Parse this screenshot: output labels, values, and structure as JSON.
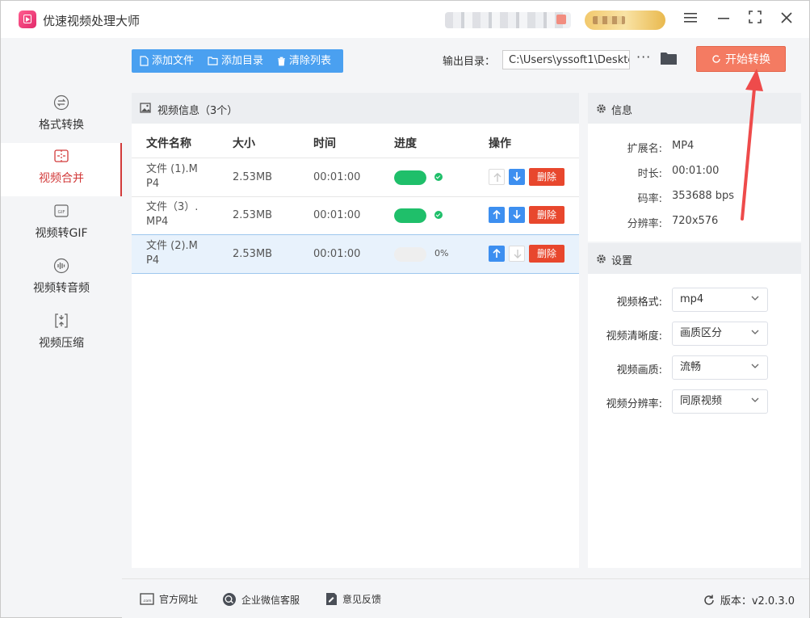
{
  "app": {
    "title": "优速视频处理大师"
  },
  "sidebar": {
    "items": [
      {
        "label": "格式转换",
        "icon": "format-convert-icon",
        "active": false
      },
      {
        "label": "视频合并",
        "icon": "video-merge-icon",
        "active": true
      },
      {
        "label": "视频转GIF",
        "icon": "gif-icon",
        "active": false
      },
      {
        "label": "视频转音频",
        "icon": "audio-icon",
        "active": false
      },
      {
        "label": "视频压缩",
        "icon": "compress-icon",
        "active": false
      }
    ]
  },
  "toolbar": {
    "add_file": "添加文件",
    "add_dir": "添加目录",
    "clear_list": "清除列表",
    "output_label": "输出目录：",
    "output_path": "C:\\Users\\yssoft1\\Deskto",
    "more": "···",
    "start": "开始转换"
  },
  "list": {
    "title": "视频信息（3个）",
    "columns": {
      "name": "文件名称",
      "size": "大小",
      "time": "时间",
      "progress": "进度",
      "actions": "操作"
    },
    "rows": [
      {
        "name": "文件 (1).M\nP4",
        "size": "2.53MB",
        "time": "00:01:00",
        "progress": 1.0,
        "done": true,
        "pct": "",
        "up_enabled": false,
        "down_enabled": true
      },
      {
        "name": "文件（3）.\nMP4",
        "size": "2.53MB",
        "time": "00:01:00",
        "progress": 1.0,
        "done": true,
        "pct": "",
        "up_enabled": true,
        "down_enabled": true
      },
      {
        "name": "文件 (2).M\nP4",
        "size": "2.53MB",
        "time": "00:01:00",
        "progress": 0.0,
        "done": false,
        "pct": "0%",
        "up_enabled": true,
        "down_enabled": false
      }
    ],
    "delete_label": "删除"
  },
  "info": {
    "title": "信息",
    "ext_label": "扩展名:",
    "ext": "MP4",
    "duration_label": "时长:",
    "duration": "00:01:00",
    "bitrate_label": "码率:",
    "bitrate": "353688 bps",
    "resolution_label": "分辨率:",
    "resolution": "720x576"
  },
  "settings": {
    "title": "设置",
    "format_label": "视频格式:",
    "format": "mp4",
    "clarity_label": "视频清晰度:",
    "clarity": "画质区分",
    "quality_label": "视频画质:",
    "quality": "流畅",
    "resolution_label": "视频分辨率:",
    "resolution": "同原视频"
  },
  "footer": {
    "website": "官方网址",
    "wechat": "企业微信客服",
    "feedback": "意见反馈",
    "version": "版本：v2.0.3.0"
  },
  "colors": {
    "accent_blue": "#4aa0f0",
    "active_red": "#d23a3a",
    "start_orange": "#f47b62",
    "progress_green": "#1fbf6a",
    "delete_red": "#e8472d",
    "annotation_arrow": "#ee4b4b"
  }
}
